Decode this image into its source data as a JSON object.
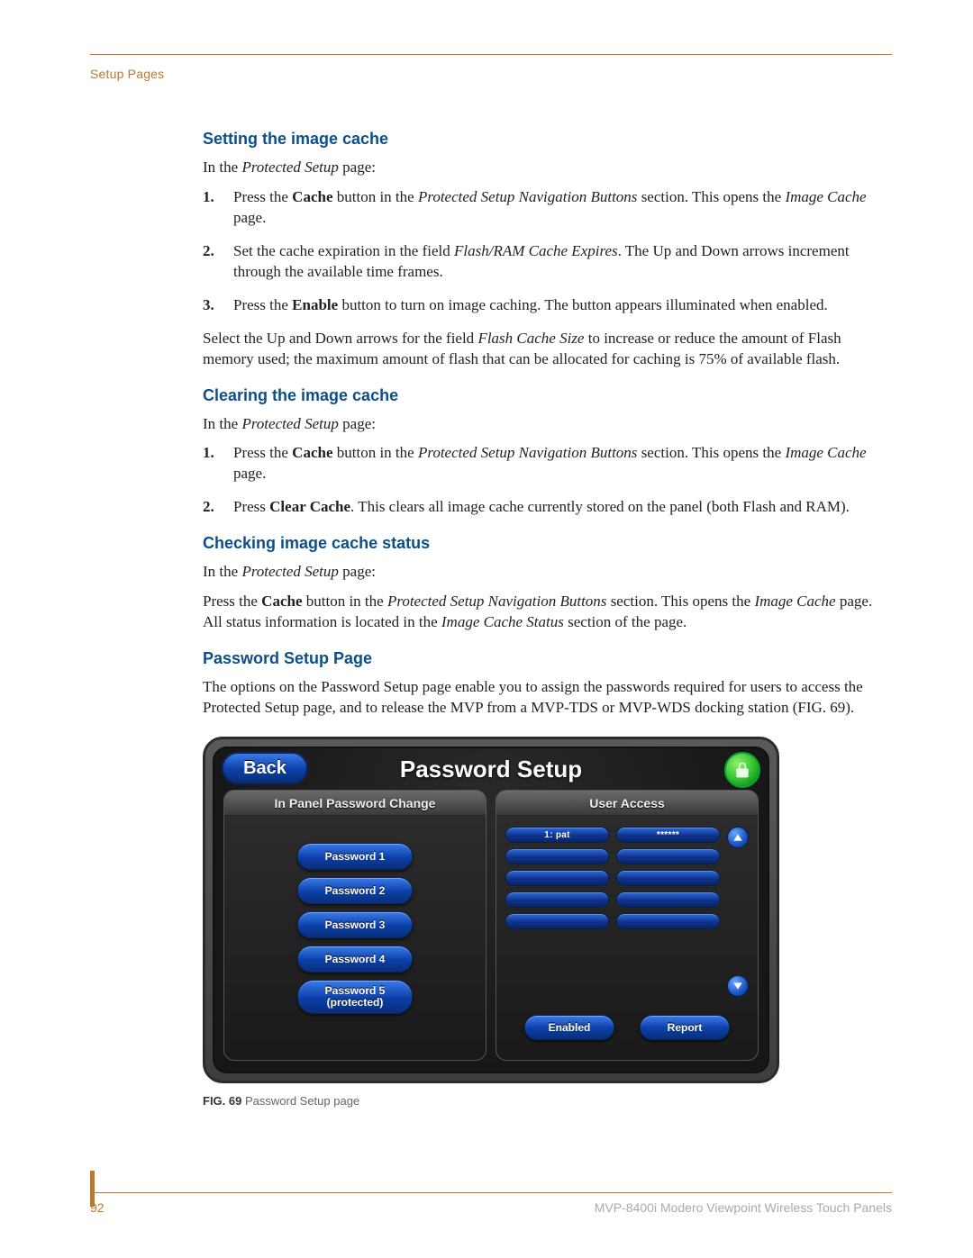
{
  "running_head": "Setup Pages",
  "sections": {
    "s1": {
      "title": "Setting the image cache",
      "intro_pre": "In the ",
      "intro_em": "Protected Setup",
      "intro_post": " page:",
      "step1_a": "Press the ",
      "step1_b": "Cache",
      "step1_c": " button in the ",
      "step1_d": "Protected Setup Navigation Buttons",
      "step1_e": " section. This opens the ",
      "step1_f": "Image Cache",
      "step1_g": " page.",
      "step2_a": "Set the cache expiration in the field ",
      "step2_b": "Flash/RAM Cache Expires",
      "step2_c": ". The Up and Down arrows increment through the available time frames.",
      "step3_a": "Press the ",
      "step3_b": "Enable",
      "step3_c": " button to turn on image caching. The button appears illuminated when enabled.",
      "para2_a": "Select the Up and Down arrows for the field ",
      "para2_b": "Flash Cache Size",
      "para2_c": " to increase or reduce the amount of Flash memory used; the maximum amount of flash that can be allocated for caching is 75% of available flash."
    },
    "s2": {
      "title": "Clearing the image cache",
      "intro_pre": "In the ",
      "intro_em": "Protected Setup",
      "intro_post": " page:",
      "step1_a": "Press the ",
      "step1_b": "Cache",
      "step1_c": " button in the ",
      "step1_d": "Protected Setup Navigation Buttons",
      "step1_e": " section. This opens the ",
      "step1_f": "Image Cache",
      "step1_g": " page.",
      "step2_a": "Press ",
      "step2_b": "Clear Cache",
      "step2_c": ". This clears all image cache currently stored on the panel (both Flash and RAM)."
    },
    "s3": {
      "title": "Checking image cache status",
      "intro_pre": "In the ",
      "intro_em": "Protected Setup",
      "intro_post": " page:",
      "p_a": "Press the ",
      "p_b": "Cache",
      "p_c": " button in the ",
      "p_d": "Protected Setup Navigation Buttons",
      "p_e": " section. This opens the ",
      "p_f": "Image Cache",
      "p_g": " page. All status information is located in the ",
      "p_h": "Image Cache Status",
      "p_i": " section of the page."
    },
    "s4": {
      "title": "Password Setup Page",
      "para": "The options on the Password Setup page enable you to assign the passwords required for users to access the Protected Setup page, and to release the MVP from a MVP-TDS or MVP-WDS docking station (FIG. 69)."
    }
  },
  "nums": {
    "n1": "1.",
    "n2": "2.",
    "n3": "3."
  },
  "figure": {
    "back": "Back",
    "title": "Password Setup",
    "left_head": "In Panel Password Change",
    "right_head": "User Access",
    "pw": [
      "Password 1",
      "Password 2",
      "Password 3",
      "Password 4"
    ],
    "pw5_l1": "Password 5",
    "pw5_l2": "(protected)",
    "ua_row0_left": "1: pat",
    "ua_row0_right": "******",
    "enabled": "Enabled",
    "report": "Report",
    "caption_lead": "FIG. 69",
    "caption_rest": "  Password Setup page"
  },
  "footer": {
    "page": "92",
    "doc": "MVP-8400i Modero Viewpoint Wireless Touch Panels"
  }
}
